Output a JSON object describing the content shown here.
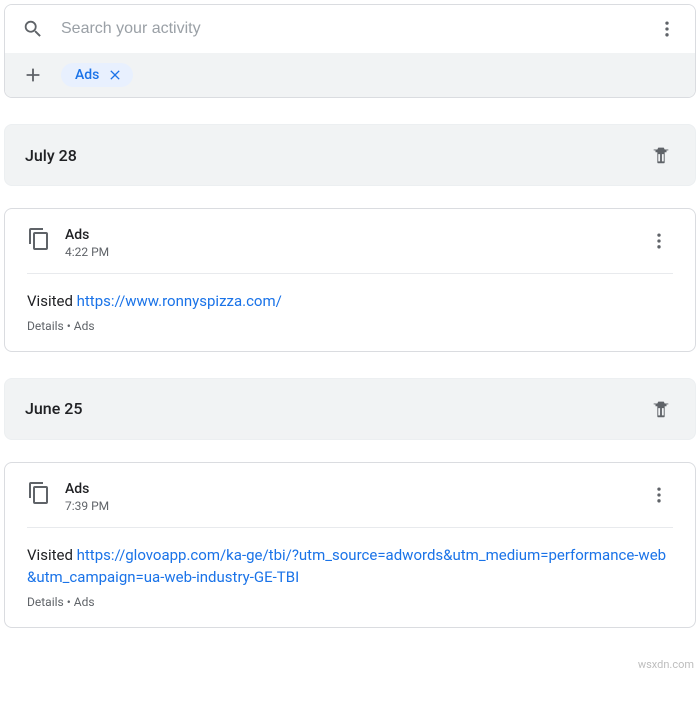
{
  "search": {
    "placeholder": "Search your activity"
  },
  "filters": {
    "chip": "Ads"
  },
  "groups": [
    {
      "date": "July 28",
      "activities": [
        {
          "service": "Ads",
          "time": "4:22 PM",
          "prefix": "Visited ",
          "link": "https://www.ronnyspizza.com/",
          "details_label": "Details",
          "category": "Ads"
        }
      ]
    },
    {
      "date": "June 25",
      "activities": [
        {
          "service": "Ads",
          "time": "7:39 PM",
          "prefix": "Visited ",
          "link": "https://glovoapp.com/ka-ge/tbi/?utm_source=adwords&utm_medium=performance-web&utm_campaign=ua-web-industry-GE-TBI",
          "details_label": "Details",
          "category": "Ads"
        }
      ]
    }
  ],
  "watermark": "wsxdn.com"
}
